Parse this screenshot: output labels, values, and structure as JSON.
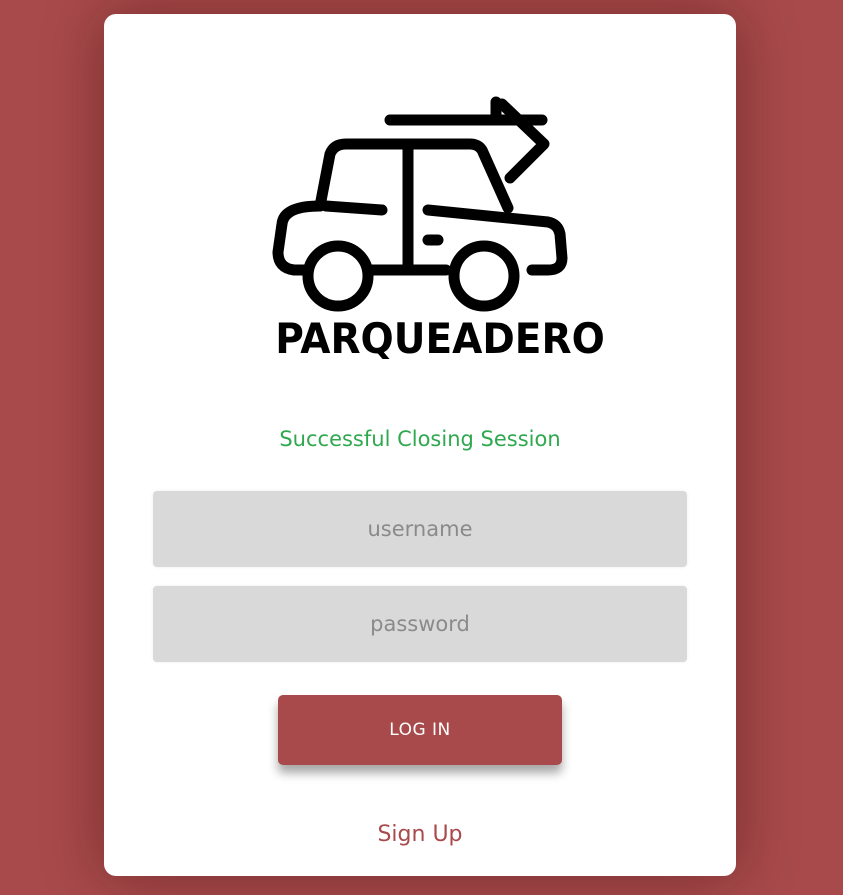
{
  "brand": {
    "logo_text": "PARQUEADERO",
    "logo_icon": "car-arrow-icon"
  },
  "status": {
    "message": "Successful Closing Session",
    "color": "#2fa84f"
  },
  "form": {
    "username_placeholder": "username",
    "username_value": "",
    "password_placeholder": "password",
    "password_value": "",
    "login_label": "LOG IN"
  },
  "footer": {
    "signup_label": "Sign Up"
  },
  "colors": {
    "background": "#a84a4b",
    "accent": "#a84a4b",
    "field_bg": "#d9d9d9",
    "success": "#2fa84f"
  }
}
